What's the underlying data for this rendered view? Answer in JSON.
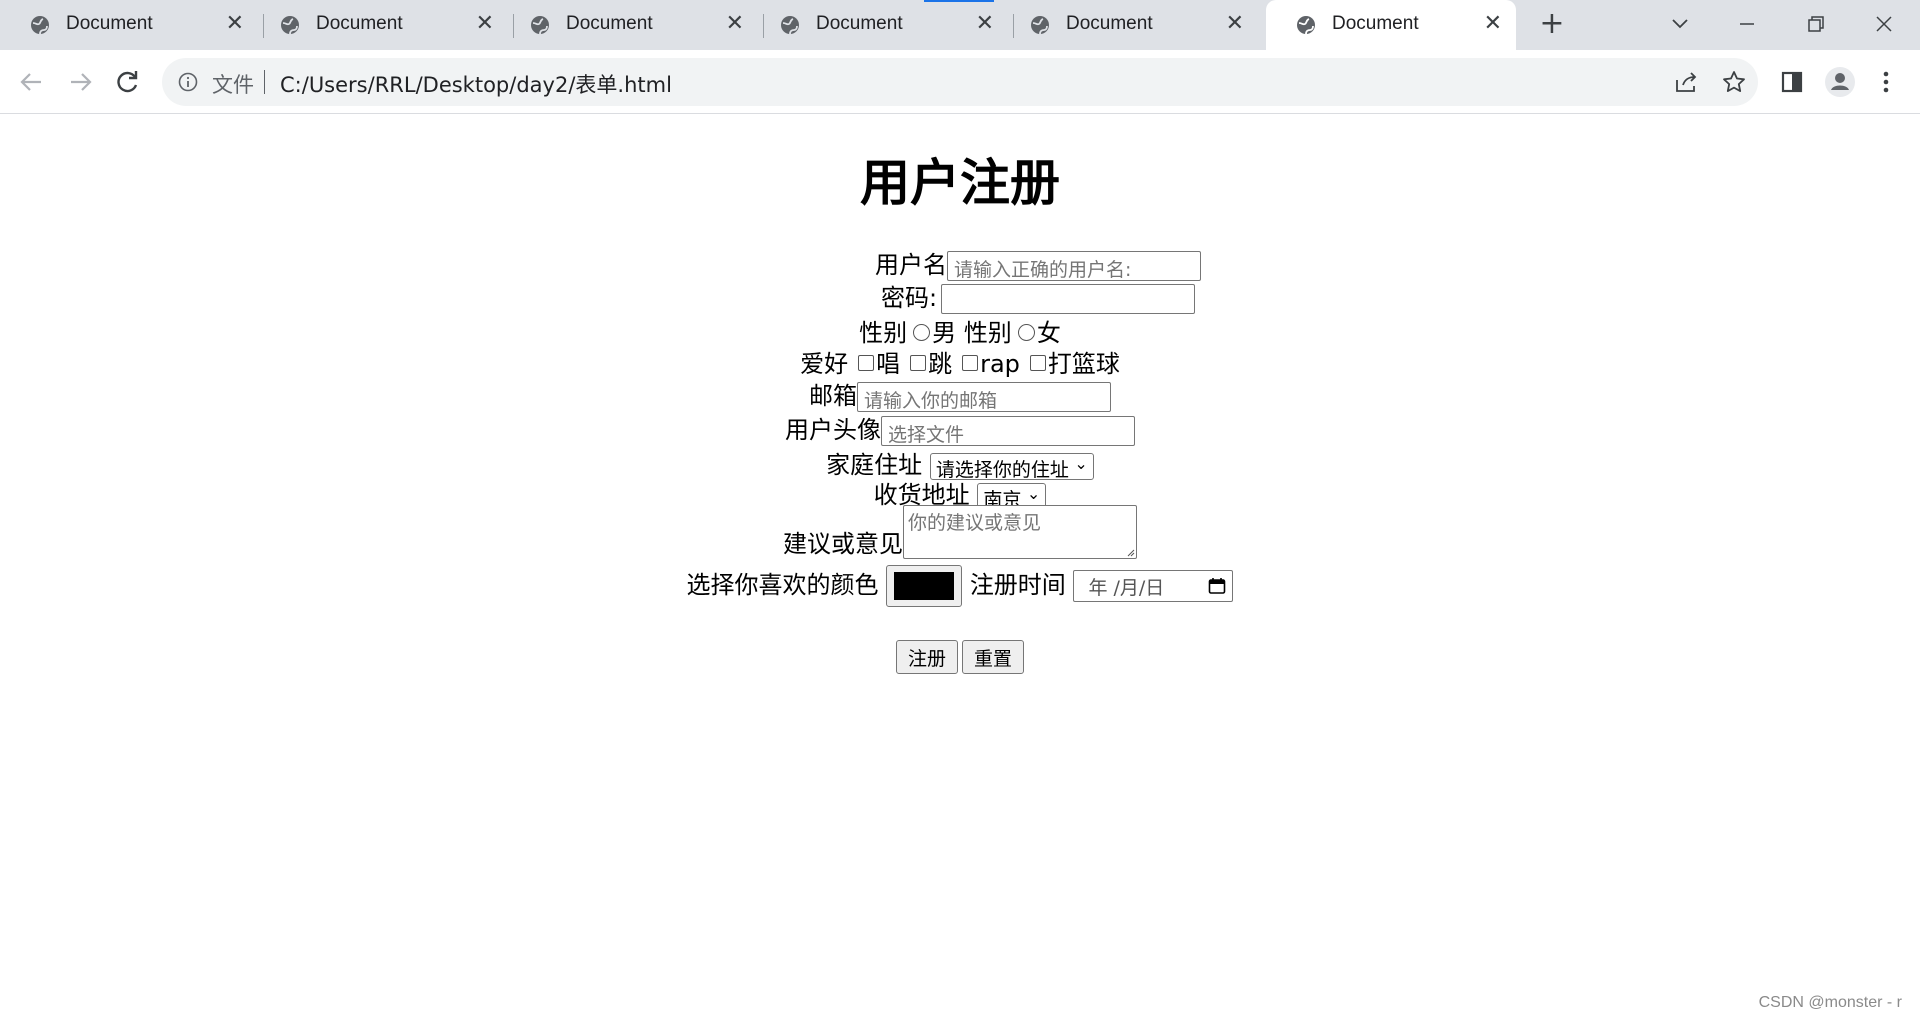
{
  "browser": {
    "tabs": [
      {
        "title": "Document",
        "active": false
      },
      {
        "title": "Document",
        "active": false
      },
      {
        "title": "Document",
        "active": false
      },
      {
        "title": "Document",
        "active": false
      },
      {
        "title": "Document",
        "active": false
      },
      {
        "title": "Document",
        "active": true
      }
    ],
    "tab_close_glyph": "✕",
    "new_tab_glyph": "+",
    "address": {
      "scheme_label": "文件",
      "url": "C:/Users/RRL/Desktop/day2/表单.html"
    },
    "colors": {
      "tabstrip": "#dee1e6",
      "omnibox": "#f1f3f4",
      "accent": "#1a73e8"
    }
  },
  "form": {
    "title": "用户注册",
    "username": {
      "label": "用户名",
      "placeholder": "请输入正确的用户名:"
    },
    "password": {
      "label": "密码:",
      "value": ""
    },
    "gender": {
      "label1": "性别",
      "option1": "男",
      "label2": "性别",
      "option2": "女"
    },
    "hobbies": {
      "label": "爱好",
      "options": [
        "唱",
        "跳",
        "rap",
        "打篮球"
      ]
    },
    "email": {
      "label": "邮箱",
      "placeholder": "请输入你的邮箱"
    },
    "avatar": {
      "label": "用户头像",
      "placeholder": "选择文件"
    },
    "home_address": {
      "label": "家庭住址",
      "selected": "请选择你的住址"
    },
    "shipping_address": {
      "label": "收货地址",
      "selected": "南京"
    },
    "suggestion": {
      "label": "建议或意见",
      "placeholder": "你的建议或意见"
    },
    "color": {
      "label": "选择你喜欢的颜色",
      "value": "#000000"
    },
    "reg_time": {
      "label": "注册时间",
      "placeholder": "年 /月/日"
    },
    "buttons": {
      "submit": "注册",
      "reset": "重置"
    }
  },
  "watermark": "CSDN @monster - r"
}
